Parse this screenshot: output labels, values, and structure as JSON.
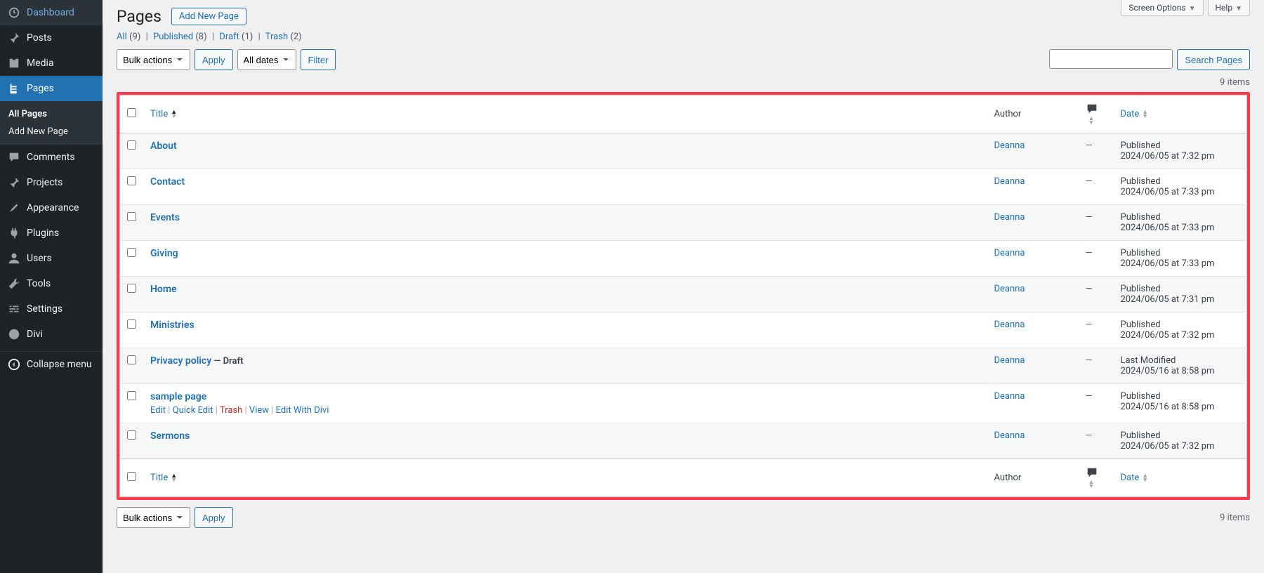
{
  "sidebar": {
    "items": [
      {
        "label": "Dashboard"
      },
      {
        "label": "Posts"
      },
      {
        "label": "Media"
      },
      {
        "label": "Pages"
      },
      {
        "label": "Comments"
      },
      {
        "label": "Projects"
      },
      {
        "label": "Appearance"
      },
      {
        "label": "Plugins"
      },
      {
        "label": "Users"
      },
      {
        "label": "Tools"
      },
      {
        "label": "Settings"
      },
      {
        "label": "Divi"
      }
    ],
    "submenu": [
      {
        "label": "All Pages"
      },
      {
        "label": "Add New Page"
      }
    ],
    "collapse": "Collapse menu"
  },
  "screen_links": {
    "screen_options": "Screen Options",
    "help": "Help"
  },
  "header": {
    "title": "Pages",
    "add_new": "Add New Page"
  },
  "filters": {
    "all_label": "All",
    "all_count": "(9)",
    "published_label": "Published",
    "published_count": "(8)",
    "draft_label": "Draft",
    "draft_count": "(1)",
    "trash_label": "Trash",
    "trash_count": "(2)"
  },
  "tablenav": {
    "bulk": "Bulk actions",
    "apply": "Apply",
    "dates": "All dates",
    "filter": "Filter",
    "search": "Search Pages",
    "count": "9 items"
  },
  "columns": {
    "title": "Title",
    "author": "Author",
    "date": "Date"
  },
  "row_actions": {
    "edit": "Edit",
    "quick_edit": "Quick Edit",
    "trash": "Trash",
    "view": "View",
    "edit_divi": "Edit With Divi"
  },
  "rows": [
    {
      "title": "About",
      "author": "Deanna",
      "comments": "—",
      "status": "Published",
      "date": "2024/06/05 at 7:32 pm"
    },
    {
      "title": "Contact",
      "author": "Deanna",
      "comments": "—",
      "status": "Published",
      "date": "2024/06/05 at 7:33 pm"
    },
    {
      "title": "Events",
      "author": "Deanna",
      "comments": "—",
      "status": "Published",
      "date": "2024/06/05 at 7:33 pm"
    },
    {
      "title": "Giving",
      "author": "Deanna",
      "comments": "—",
      "status": "Published",
      "date": "2024/06/05 at 7:33 pm"
    },
    {
      "title": "Home",
      "author": "Deanna",
      "comments": "—",
      "status": "Published",
      "date": "2024/06/05 at 7:31 pm"
    },
    {
      "title": "Ministries",
      "author": "Deanna",
      "comments": "—",
      "status": "Published",
      "date": "2024/06/05 at 7:32 pm"
    },
    {
      "title": "Privacy policy",
      "state": " — Draft",
      "author": "Deanna",
      "comments": "—",
      "status": "Last Modified",
      "date": "2024/05/16 at 8:58 pm"
    },
    {
      "title": "sample page",
      "show_actions": true,
      "author": "Deanna",
      "comments": "—",
      "status": "Published",
      "date": "2024/05/16 at 8:58 pm"
    },
    {
      "title": "Sermons",
      "author": "Deanna",
      "comments": "—",
      "status": "Published",
      "date": "2024/06/05 at 7:32 pm"
    }
  ]
}
